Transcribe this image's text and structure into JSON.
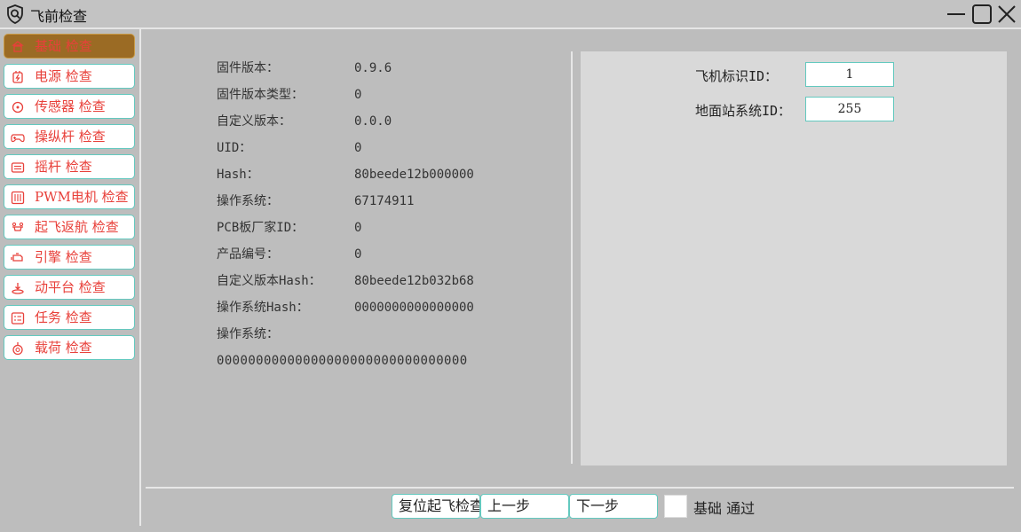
{
  "window": {
    "title": "飞前检查",
    "app_icon": "shield-search-icon",
    "controls": [
      "minimize-icon",
      "maximize-icon",
      "close-icon"
    ]
  },
  "sidebar": {
    "items": [
      {
        "label": "基础 检查",
        "icon": "base-icon",
        "active": true
      },
      {
        "label": "电源 检查",
        "icon": "power-icon",
        "active": false
      },
      {
        "label": "传感器 检查",
        "icon": "sensor-icon",
        "active": false
      },
      {
        "label": "操纵杆 检查",
        "icon": "gamepad-icon",
        "active": false
      },
      {
        "label": "摇杆 检查",
        "icon": "joystick-icon",
        "active": false
      },
      {
        "label": "PWM电机 检查",
        "icon": "motor-icon",
        "active": false
      },
      {
        "label": "起飞返航 检查",
        "icon": "takeoff-icon",
        "active": false
      },
      {
        "label": "引擎 检查",
        "icon": "engine-icon",
        "active": false
      },
      {
        "label": "动平台 检查",
        "icon": "platform-icon",
        "active": false
      },
      {
        "label": "任务 检查",
        "icon": "task-icon",
        "active": false
      },
      {
        "label": "载荷 检查",
        "icon": "payload-icon",
        "active": false
      }
    ]
  },
  "info": {
    "rows": [
      {
        "label": "固件版本：",
        "value": "0.9.6"
      },
      {
        "label": "固件版本类型：",
        "value": "0"
      },
      {
        "label": "自定义版本：",
        "value": "0.0.0"
      },
      {
        "label": "UID：",
        "value": "0"
      },
      {
        "label": "Hash：",
        "value": "80beede12b000000"
      },
      {
        "label": "操作系统：",
        "value": "67174911"
      },
      {
        "label": "PCB板厂家ID：",
        "value": "0"
      },
      {
        "label": "产品编号：",
        "value": "0"
      },
      {
        "label": "自定义版本Hash：",
        "value": "80beede12b032b68"
      },
      {
        "label": "操作系统Hash：",
        "value": "0000000000000000"
      },
      {
        "label": "操作系统：",
        "value": ""
      }
    ],
    "long_value": "00000000000000000000000000000000"
  },
  "ids": {
    "aircraft_label": "飞机标识ID：",
    "aircraft_value": "1",
    "gcs_label": "地面站系统ID：",
    "gcs_value": "255"
  },
  "footer": {
    "reset_button": "复位起飞检查",
    "prev_button": "上一步",
    "next_button": "下一步",
    "check_label": "基础 通过",
    "checked": false
  },
  "colors": {
    "accent_border": "#63c9bf",
    "sidebar_text": "#e8403a",
    "active_item_bg": "#9b6b24",
    "panel_bg": "#d9d9d9"
  }
}
